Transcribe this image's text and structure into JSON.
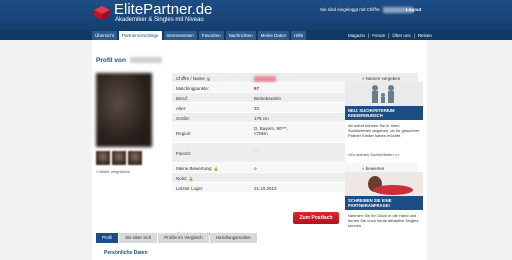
{
  "brand": {
    "title": "ElitePartner.de",
    "subtitle": "Akademiker & Singles mit Niveau",
    "accent": "#1d4d86",
    "logo_red": "#d7102a"
  },
  "header": {
    "login_status": "Sie sind eingeloggt mit Chiffre",
    "logout": "Logout"
  },
  "nav": {
    "tabs": [
      {
        "label": "Übersicht"
      },
      {
        "label": "Partnervorschläge"
      },
      {
        "label": "Interessenten"
      },
      {
        "label": "Favoriten"
      },
      {
        "label": "Nachrichten"
      },
      {
        "label": "Meine Daten"
      },
      {
        "label": "Hilfe"
      }
    ],
    "right_links": [
      {
        "label": "Magazin"
      },
      {
        "label": "Forum"
      },
      {
        "label": "Über uns"
      },
      {
        "label": "Reisen"
      }
    ]
  },
  "profile": {
    "title": "Profil von",
    "more_photos": "» Bilder vergrößern",
    "not_visible_note": "nicht sichtbar für andere",
    "rows": [
      {
        "label": "Chiffre / Name",
        "value": "",
        "action": "» Namen vergeben",
        "lock": true
      },
      {
        "label": "Matchingpunkte:",
        "value": "97",
        "value_red": true
      },
      {
        "label": "Beruf:",
        "value": "Betriebswirtin"
      },
      {
        "label": "Alter:",
        "value": "33"
      },
      {
        "label": "Größe:",
        "value": "176 cm"
      },
      {
        "label": "Region:",
        "value": "D, Bayern, 90***,\n<70km"
      },
      {
        "label": "Favorit:",
        "value": "♡"
      },
      {
        "label": "Meine Bewertung:",
        "value": "o",
        "action": "» bewerten",
        "lock": true
      },
      {
        "label": "Notiz:",
        "value": "",
        "action": "» Notiz schreiben",
        "lock": true
      },
      {
        "label": "Letzter Login:",
        "value": "21.10.2013"
      }
    ],
    "postfach_button": "Zum Postfach",
    "bottom_tabs": [
      {
        "label": "Profil"
      },
      {
        "label": "Sie über sich"
      },
      {
        "label": "Profile im Vergleich"
      },
      {
        "label": "Handlungsmotive"
      }
    ],
    "section_title": "Persönliche Daten"
  },
  "sidebar": {
    "ads": [
      {
        "title": "NEU: SUCHKRITERIUM KINDERWUNSCH",
        "text": "Ab sofort können Sie in Ihren Suchkriterien angeben, ob Ihr gesuchter Partner Kinder haben möchte.",
        "link": "»Zu meinen Suchkriterien >>"
      },
      {
        "title": "SCHREIBEN SIE EINE PARTNERANFRAGE!",
        "text": "Nehmen Sie Ihr Glück in die Hand und lernen Sie noch heute attraktive Singles kennen."
      }
    ]
  }
}
